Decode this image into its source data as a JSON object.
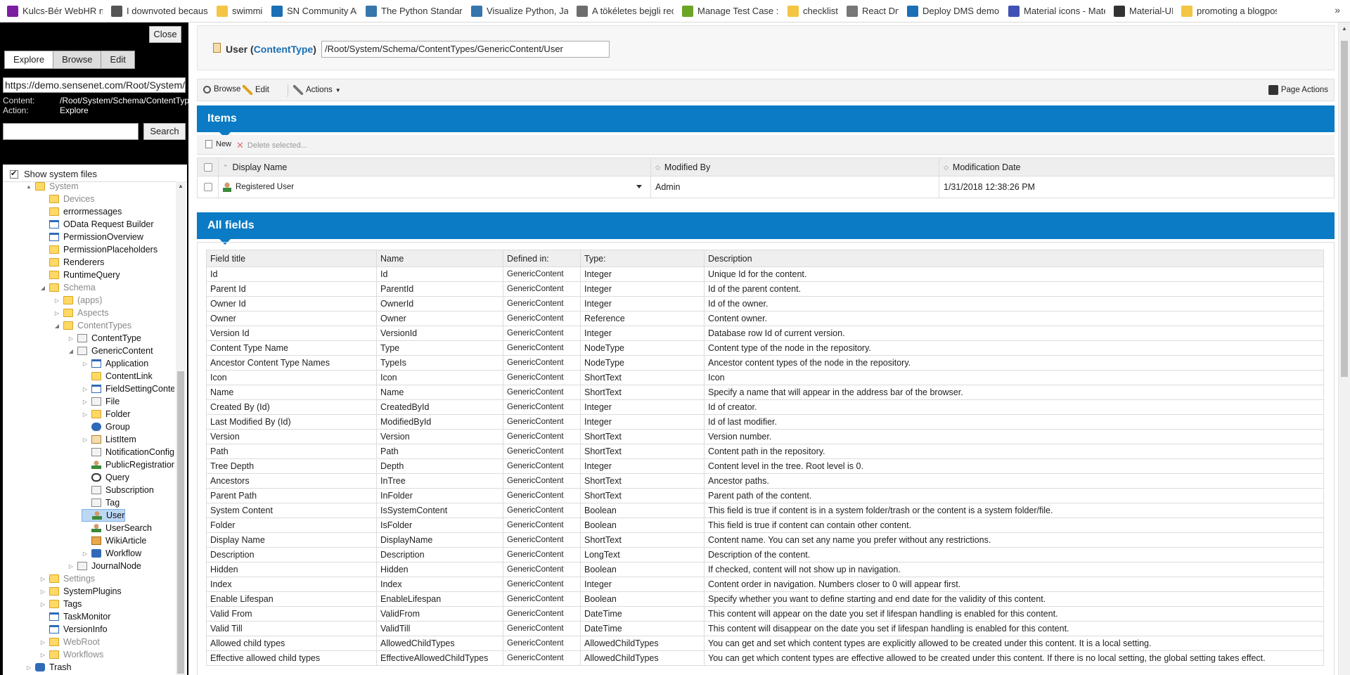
{
  "bookmarks": [
    {
      "label": "Kulcs-Bér WebHR mo",
      "icon": "kulcs-icon",
      "color": "#7b1fa2"
    },
    {
      "label": "I downvoted because",
      "icon": "download-circle-icon",
      "color": "#555555"
    },
    {
      "label": "swimming",
      "icon": "folder-icon",
      "color": "#f4c542"
    },
    {
      "label": "SN Community App",
      "icon": "sn-logo-icon",
      "color": "#1a6fb5"
    },
    {
      "label": "The Python Standard",
      "icon": "python-icon",
      "color": "#3776ab"
    },
    {
      "label": "Visualize Python, Java",
      "icon": "python-icon",
      "color": "#3776ab"
    },
    {
      "label": "A tökéletes bejgli rec",
      "icon": "recipe-icon",
      "color": "#6d6d6d"
    },
    {
      "label": "Manage Test Case : K",
      "icon": "exclamation-icon",
      "color": "#6aa526"
    },
    {
      "label": "checklists",
      "icon": "folder-icon",
      "color": "#f4c542"
    },
    {
      "label": "React DnD",
      "icon": "page-icon",
      "color": "#777777"
    },
    {
      "label": "Deploy DMS demo C",
      "icon": "azure-devops-icon",
      "color": "#1a6fb5"
    },
    {
      "label": "Material icons - Mate",
      "icon": "material-icon",
      "color": "#3f51b5"
    },
    {
      "label": "Material-UI",
      "icon": "material-ui-icon",
      "color": "#333333"
    },
    {
      "label": "promoting a blogpos",
      "icon": "folder-icon",
      "color": "#f4c542"
    }
  ],
  "bookmarks_more": "»",
  "sidebar": {
    "close_label": "Close",
    "tabs": [
      "Explore",
      "Browse",
      "Edit"
    ],
    "url": "https://demo.sensenet.com/Root/System/Schema/ContentTypes/GenericContent/User",
    "content_key": "Content:",
    "content_value": "/Root/System/Schema/ContentTypes/GenericContent/User",
    "action_key": "Action:",
    "action_value": "Explore",
    "search_value": "",
    "search_label": "Search",
    "show_system_files": "Show system files",
    "tree": [
      {
        "label": "System",
        "icon": "folder",
        "gray": true,
        "toggle": "▲"
      },
      {
        "label": "Devices",
        "icon": "folder",
        "gray": true,
        "toggle": ""
      },
      {
        "label": "errormessages",
        "icon": "folder",
        "gray": false,
        "toggle": ""
      },
      {
        "label": "OData Request Builder",
        "icon": "page",
        "gray": false,
        "toggle": ""
      },
      {
        "label": "PermissionOverview",
        "icon": "page",
        "gray": false,
        "toggle": ""
      },
      {
        "label": "PermissionPlaceholders",
        "icon": "folder",
        "gray": false,
        "toggle": ""
      },
      {
        "label": "Renderers",
        "icon": "folder",
        "gray": false,
        "toggle": ""
      },
      {
        "label": "RuntimeQuery",
        "icon": "folder",
        "gray": false,
        "toggle": ""
      },
      {
        "label": "Schema",
        "icon": "folder",
        "gray": true,
        "toggle": "◢"
      },
      {
        "label": "(apps)",
        "icon": "folder",
        "gray": true,
        "toggle": "▷"
      },
      {
        "label": "Aspects",
        "icon": "folder",
        "gray": true,
        "toggle": "▷"
      },
      {
        "label": "ContentTypes",
        "icon": "folder",
        "gray": true,
        "toggle": "◢"
      },
      {
        "label": "ContentType",
        "icon": "doc",
        "gray": false,
        "toggle": "▷"
      },
      {
        "label": "GenericContent",
        "icon": "doc",
        "gray": false,
        "toggle": "◢"
      },
      {
        "label": "Application",
        "icon": "page",
        "gray": false,
        "toggle": "▷"
      },
      {
        "label": "ContentLink",
        "icon": "folder",
        "gray": false,
        "toggle": ""
      },
      {
        "label": "FieldSettingContent",
        "icon": "page",
        "gray": false,
        "toggle": "▷"
      },
      {
        "label": "File",
        "icon": "doc",
        "gray": false,
        "toggle": "▷"
      },
      {
        "label": "Folder",
        "icon": "folder",
        "gray": false,
        "toggle": "▷"
      },
      {
        "label": "Group",
        "icon": "group",
        "gray": false,
        "toggle": ""
      },
      {
        "label": "ListItem",
        "icon": "list",
        "gray": false,
        "toggle": "▷"
      },
      {
        "label": "NotificationConfig",
        "icon": "doc",
        "gray": false,
        "toggle": ""
      },
      {
        "label": "PublicRegistrationConfig",
        "icon": "user",
        "gray": false,
        "toggle": ""
      },
      {
        "label": "Query",
        "icon": "query",
        "gray": false,
        "toggle": ""
      },
      {
        "label": "Subscription",
        "icon": "doc",
        "gray": false,
        "toggle": ""
      },
      {
        "label": "Tag",
        "icon": "doc",
        "gray": false,
        "toggle": ""
      },
      {
        "label": "User",
        "icon": "user",
        "gray": false,
        "toggle": "",
        "selected": true
      },
      {
        "label": "UserSearch",
        "icon": "user",
        "gray": false,
        "toggle": ""
      },
      {
        "label": "WikiArticle",
        "icon": "wiki",
        "gray": false,
        "toggle": ""
      },
      {
        "label": "Workflow",
        "icon": "flow",
        "gray": false,
        "toggle": "▷"
      },
      {
        "label": "JournalNode",
        "icon": "doc",
        "gray": false,
        "toggle": "▷"
      },
      {
        "label": "Settings",
        "icon": "folder",
        "gray": true,
        "toggle": "▷"
      },
      {
        "label": "SystemPlugins",
        "icon": "folder",
        "gray": false,
        "toggle": "▷"
      },
      {
        "label": "Tags",
        "icon": "folder",
        "gray": false,
        "toggle": "▷"
      },
      {
        "label": "TaskMonitor",
        "icon": "page",
        "gray": false,
        "toggle": ""
      },
      {
        "label": "VersionInfo",
        "icon": "page",
        "gray": false,
        "toggle": ""
      },
      {
        "label": "WebRoot",
        "icon": "folder",
        "gray": true,
        "toggle": "▷"
      },
      {
        "label": "Workflows",
        "icon": "folder",
        "gray": true,
        "toggle": "▷"
      },
      {
        "label": "Trash",
        "icon": "db",
        "gray": false,
        "toggle": "▷"
      }
    ]
  },
  "header": {
    "title_prefix": "User (",
    "title_type": "ContentType",
    "title_suffix": ")",
    "path": "/Root/System/Schema/ContentTypes/GenericContent/User"
  },
  "toolbar": {
    "browse": "Browse",
    "edit": "Edit",
    "actions": "Actions",
    "page_actions": "Page Actions"
  },
  "items": {
    "title": "Items",
    "new_label": "New",
    "delete_label": "Delete selected...",
    "columns": [
      "Display Name",
      "Modified By",
      "Modification Date"
    ],
    "rows": [
      {
        "display_name": "Registered User",
        "modified_by": "Admin",
        "modification_date": "1/31/2018 12:38:26 PM"
      }
    ]
  },
  "all_fields": {
    "title": "All fields",
    "columns": [
      "Field title",
      "Name",
      "Defined in:",
      "Type:",
      "Description"
    ],
    "rows": [
      [
        "Id",
        "Id",
        "GenericContent",
        "Integer",
        "Unique Id for the content."
      ],
      [
        "Parent Id",
        "ParentId",
        "GenericContent",
        "Integer",
        "Id of the parent content."
      ],
      [
        "Owner Id",
        "OwnerId",
        "GenericContent",
        "Integer",
        "Id of the owner."
      ],
      [
        "Owner",
        "Owner",
        "GenericContent",
        "Reference",
        "Content owner."
      ],
      [
        "Version Id",
        "VersionId",
        "GenericContent",
        "Integer",
        "Database row Id of current version."
      ],
      [
        "Content Type Name",
        "Type",
        "GenericContent",
        "NodeType",
        "Content type of the node in the repository."
      ],
      [
        "Ancestor Content Type Names",
        "TypeIs",
        "GenericContent",
        "NodeType",
        "Ancestor content types of the node in the repository."
      ],
      [
        "Icon",
        "Icon",
        "GenericContent",
        "ShortText",
        "Icon"
      ],
      [
        "Name",
        "Name",
        "GenericContent",
        "ShortText",
        "Specify a name that will appear in the address bar of the browser."
      ],
      [
        "Created By (Id)",
        "CreatedById",
        "GenericContent",
        "Integer",
        "Id of creator."
      ],
      [
        "Last Modified By (Id)",
        "ModifiedById",
        "GenericContent",
        "Integer",
        "Id of last modifier."
      ],
      [
        "Version",
        "Version",
        "GenericContent",
        "ShortText",
        "Version number."
      ],
      [
        "Path",
        "Path",
        "GenericContent",
        "ShortText",
        "Content path in the repository."
      ],
      [
        "Tree Depth",
        "Depth",
        "GenericContent",
        "Integer",
        "Content level in the tree. Root level is 0."
      ],
      [
        "Ancestors",
        "InTree",
        "GenericContent",
        "ShortText",
        "Ancestor paths."
      ],
      [
        "Parent Path",
        "InFolder",
        "GenericContent",
        "ShortText",
        "Parent path of the content."
      ],
      [
        "System Content",
        "IsSystemContent",
        "GenericContent",
        "Boolean",
        "This field is true if content is in a system folder/trash or the content is a system folder/file."
      ],
      [
        "Folder",
        "IsFolder",
        "GenericContent",
        "Boolean",
        "This field is true if content can contain other content."
      ],
      [
        "Display Name",
        "DisplayName",
        "GenericContent",
        "ShortText",
        "Content name. You can set any name you prefer without any restrictions."
      ],
      [
        "Description",
        "Description",
        "GenericContent",
        "LongText",
        "Description of the content."
      ],
      [
        "Hidden",
        "Hidden",
        "GenericContent",
        "Boolean",
        "If checked, content will not show up in navigation."
      ],
      [
        "Index",
        "Index",
        "GenericContent",
        "Integer",
        "Content order in navigation. Numbers closer to 0 will appear first."
      ],
      [
        "Enable Lifespan",
        "EnableLifespan",
        "GenericContent",
        "Boolean",
        "Specify whether you want to define starting and end date for the validity of this content."
      ],
      [
        "Valid From",
        "ValidFrom",
        "GenericContent",
        "DateTime",
        "This content will appear on the date you set if lifespan handling is enabled for this content."
      ],
      [
        "Valid Till",
        "ValidTill",
        "GenericContent",
        "DateTime",
        "This content will disappear on the date you set if lifespan handling is enabled for this content."
      ],
      [
        "Allowed child types",
        "AllowedChildTypes",
        "GenericContent",
        "AllowedChildTypes",
        "You can get and set which content types are explicitly allowed to be created under this content. It is a local setting."
      ],
      [
        "Effective allowed child types",
        "EffectiveAllowedChildTypes",
        "GenericContent",
        "AllowedChildTypes",
        "You can get which content types are effective allowed to be created under this content. If there is no local setting, the global setting takes effect."
      ]
    ]
  }
}
